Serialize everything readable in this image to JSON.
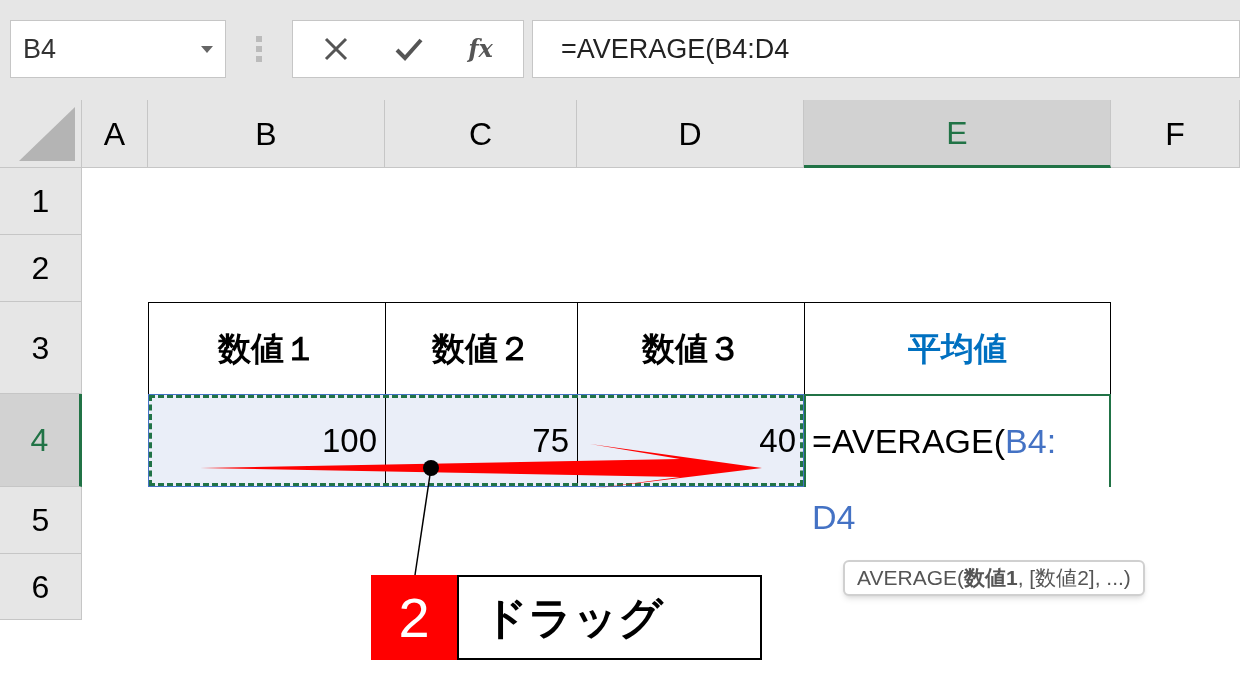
{
  "name_box": {
    "value": "B4"
  },
  "formula_buttons": [
    {
      "kind": "cancel"
    },
    {
      "kind": "enter"
    },
    {
      "kind": "function",
      "label": "fx"
    }
  ],
  "formula_bar": {
    "value": "=AVERAGE(B4:D4"
  },
  "columns": [
    {
      "label": "A",
      "selected": false
    },
    {
      "label": "B",
      "selected": false
    },
    {
      "label": "C",
      "selected": false
    },
    {
      "label": "D",
      "selected": false
    },
    {
      "label": "E",
      "selected": true
    },
    {
      "label": "F",
      "selected": false
    }
  ],
  "rows": [
    {
      "label": "1",
      "selected": false
    },
    {
      "label": "2",
      "selected": false
    },
    {
      "label": "3",
      "selected": false
    },
    {
      "label": "4",
      "selected": true
    },
    {
      "label": "5",
      "selected": false
    },
    {
      "label": "6",
      "selected": false
    }
  ],
  "table": {
    "headers": [
      {
        "text": "数値１",
        "color": "#000000"
      },
      {
        "text": "数値２",
        "color": "#000000"
      },
      {
        "text": "数値３",
        "color": "#000000"
      },
      {
        "text": "平均値",
        "color": "#0070c0"
      }
    ],
    "values": [
      {
        "text": "100",
        "selected": true
      },
      {
        "text": "75",
        "selected": true
      },
      {
        "text": "40",
        "selected": true
      }
    ],
    "editing_cell": {
      "text": "=AVERAGE(",
      "references": [
        "B4:",
        "D4"
      ]
    }
  },
  "tooltip": "AVERAGE(**数値1**, [数値2], ...)",
  "callout": {
    "number": "2",
    "label": "ドラッグ"
  }
}
